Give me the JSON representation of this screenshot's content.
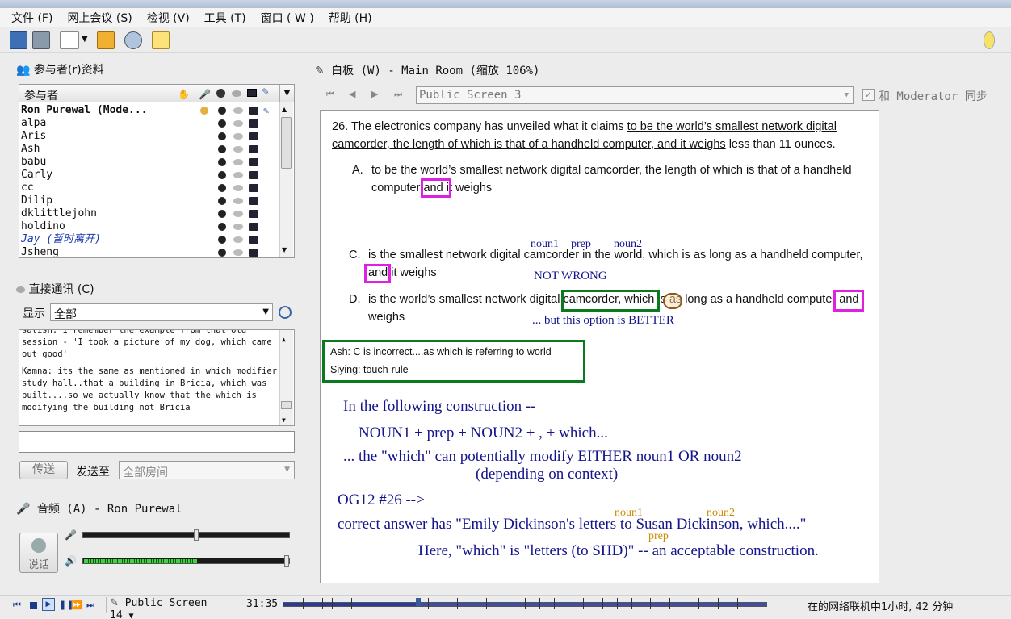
{
  "menu": [
    "文件 (F)",
    "网上会议 (S)",
    "检视 (V)",
    "工具 (T)",
    "窗口 ( W )",
    "帮助 (H)"
  ],
  "participants": {
    "title": "参与者(r)资料",
    "header": "参与者",
    "list": [
      {
        "name": "Ron Purewal (Mode...",
        "bold": true
      },
      {
        "name": "alpa"
      },
      {
        "name": "Aris"
      },
      {
        "name": "Ash"
      },
      {
        "name": "babu"
      },
      {
        "name": "Carly"
      },
      {
        "name": "cc"
      },
      {
        "name": "Dilip"
      },
      {
        "name": "dklittlejohn"
      },
      {
        "name": "holdino"
      },
      {
        "name": "Jay (暂时离开)",
        "away": true
      },
      {
        "name": "Jsheng"
      }
    ]
  },
  "chat": {
    "title": "直接通讯 (C)",
    "display_label": "显示",
    "display_value": "全部",
    "messages": [
      "satish: I remember the example from that old session - 'I took a picture of my dog, which came out good'",
      "Kamna: its the same as mentioned in which modifier study hall..that a building in Bricia, which was built....so we actually know that the which is modifying the building not Bricia"
    ],
    "send_label": "传送",
    "send_to_label": "发送至",
    "send_to_value": "全部房间"
  },
  "audio": {
    "title": "音频 (A) - Ron Purewal",
    "talk_label": "说话",
    "mic_level": 0.55,
    "speaker_level": 1.0,
    "activity_level": 0.55
  },
  "whiteboard": {
    "title": "白板 (W) - Main Room (缩放 106%)",
    "screen_select": "Public Screen 3",
    "sync_label": "和 Moderator 同步",
    "question_num": "26.",
    "question_pre": "The electronics company has unveiled what it claims",
    "question_ul1": "to be the world’s smallest network digital",
    "question_ul2": "camcorder, the length of which is that of a handheld computer, and it weighs",
    "question_post": "less than 11 ounces.",
    "opt_a_label": "A.",
    "opt_a_line1": "to be the world’s smallest network digital camcorder, the length of which is that of a handheld",
    "opt_a_line2_pre": "computer",
    "opt_a_and": "and",
    "opt_a_line2_post": "it weighs",
    "noun1": "noun1",
    "prep": "prep",
    "noun2": "noun2",
    "opt_c_label": "C.",
    "opt_c_line1": "is the smallest network digital camcorder in the world, which is as long as a handheld computer,",
    "opt_c_and": "and",
    "opt_c_line2": "it weighs",
    "not_wrong": "NOT WRONG",
    "opt_d_label": "D.",
    "opt_d_pre": "is the world’s smallest network digital",
    "opt_d_box": "camcorder, which",
    "opt_d_mid": "is as long as a handheld computer",
    "opt_d_and": "and",
    "opt_d_line2": "weighs",
    "better": "... but this option is BETTER",
    "chat_lines": [
      "Ash: C is incorrect....as which is referring to world",
      "Siying: touch-rule"
    ],
    "notes": [
      "In the following construction --",
      "NOUN1 + prep + NOUN2 + , + which...",
      "... the \"which\" can potentially modify EITHER noun1 OR noun2",
      "(depending on context)",
      "OG12 #26 -->",
      "correct answer has \"Emily Dickinson's letters to Susan Dickinson, which....\"",
      "Here, \"which\" is \"letters (to SHD)\" -- an acceptable construction."
    ],
    "og_noun1": "noun1",
    "og_noun2": "noun2",
    "og_prep": "prep"
  },
  "status": {
    "screen": "Public Screen 14",
    "time": "31:35",
    "online": "在的网络联机中1小时, 42 分钟",
    "progress": 0.28
  },
  "colors": {
    "magenta": "#e020e0",
    "green": "#0a7a1f",
    "navy": "#14148c",
    "orange": "#c98a00"
  }
}
